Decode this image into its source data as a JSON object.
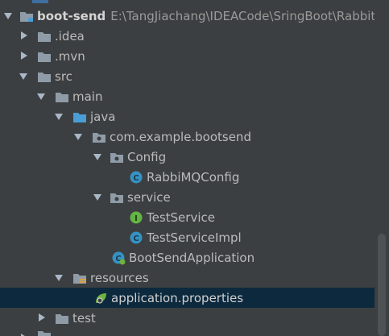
{
  "tree": {
    "root": {
      "name": "boot-send",
      "path": "E:\\TangJiachang\\IDEACode\\SringBoot\\RabbitM"
    },
    "idea": ".idea",
    "mvn": ".mvn",
    "src": "src",
    "main": "main",
    "java": "java",
    "package": "com.example.bootsend",
    "config_pkg": "Config",
    "rabbit_config": "RabbiMQConfig",
    "service_pkg": "service",
    "test_service": "TestService",
    "test_service_impl": "TestServiceImpl",
    "boot_app": "BootSendApplication",
    "resources": "resources",
    "app_props": "application.properties",
    "test": "test"
  },
  "colors": {
    "background": "#3c3f41",
    "selection": "#0d293e",
    "folder": "#8f9ca8",
    "source_folder": "#4a9ed6",
    "class_icon": "#3592c4",
    "interface_icon": "#62b543"
  }
}
